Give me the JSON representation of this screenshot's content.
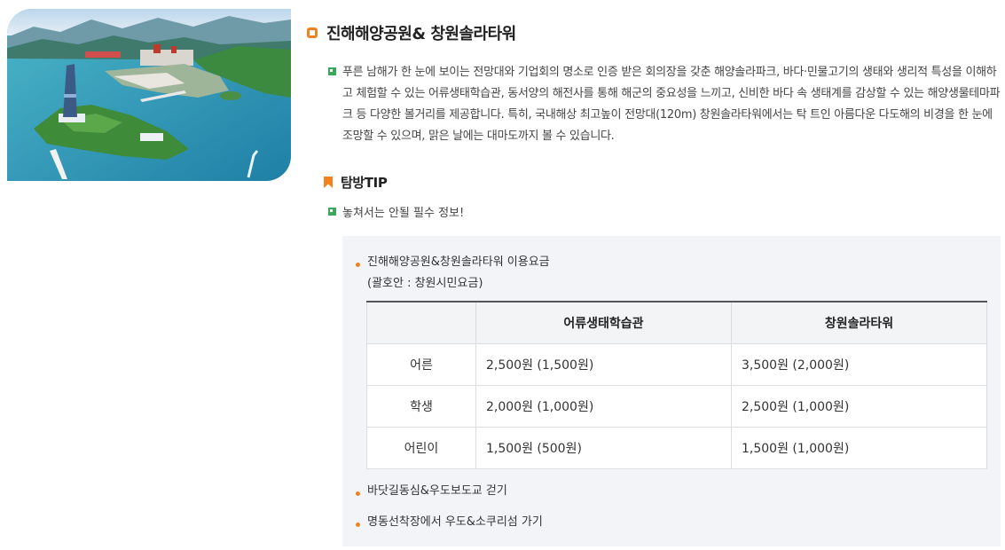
{
  "section": {
    "title": "진해해양공원& 창원솔라타워",
    "description": "푸른 남해가 한 눈에 보이는 전망대와 기업회의 명소로 인증 받은 회의장을 갖춘 해양솔라파크, 바다·민물고기의 생태와 생리적 특성을 이해하고 체험할 수 있는 어류생태학습관, 동서양의 해전사를 통해 해군의 중요성을 느끼고, 신비한 바다 속 생태계를 감상할 수 있는 해양생물테마파크 등 다양한 볼거리를 제공합니다. 특히, 국내해상 최고높이 전망대(120m) 창원솔라타워에서는 탁 트인 아름다운 다도해의 비경을 한 눈에 조망할 수 있으며, 맑은 날에는 대마도까지 볼 수 있습니다."
  },
  "tip": {
    "heading": "탐방TIP",
    "note": "놓쳐서는 안될 필수 정보!"
  },
  "info": {
    "fee_title": "진해해양공원&창원솔라타워 이용요금",
    "fee_subtitle": "(괄호안 : 창원시민요금)",
    "table": {
      "headers": [
        "",
        "어류생태학습관",
        "창원솔라타워"
      ],
      "rows": [
        {
          "label": "어른",
          "fish": "2,500원 (1,500원)",
          "tower": "3,500원 (2,000원)"
        },
        {
          "label": "학생",
          "fish": "2,000원 (1,000원)",
          "tower": "2,500원 (1,000원)"
        },
        {
          "label": "어린이",
          "fish": "1,500원 (500원)",
          "tower": "1,500원 (1,000원)"
        }
      ]
    },
    "extra_items": [
      "바닷길동심&우도보도교 걷기",
      "명동선착장에서 우도&소쿠리섬 가기"
    ]
  },
  "colors": {
    "accent_orange": "#f0831f",
    "bullet_green": "#3aa75a",
    "box_bg": "#f3f4f8"
  }
}
